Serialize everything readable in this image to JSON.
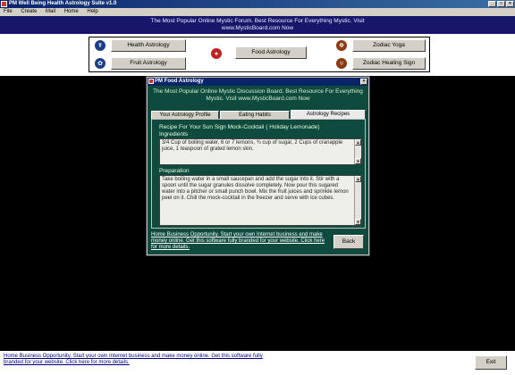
{
  "window": {
    "title": "PM Well Being Health Astrology Suite v1.0",
    "buttons": [
      "_",
      "□",
      "×"
    ]
  },
  "menu": [
    "File",
    "Create",
    "Mail",
    "Home",
    "Help"
  ],
  "banner": {
    "line1": "The Most Popular Online Mystic Forum. Best Resource For Everything Mystic. Visit",
    "line2": "www.MysticBoard.com Now"
  },
  "nav": {
    "health_astrology": "Health Astrology",
    "fruit_astrology": "Fruit Astrology",
    "food_astrology": "Food Astrology",
    "zodiac_yoga": "Zodiac Yoga",
    "zodiac_healing_sign": "Zodiac Healing Sign"
  },
  "dialog": {
    "title": "PM Food Astrology",
    "close": "×",
    "header": "The Most Popular Online Mystic Discussion Board. Best Resource For Everything Mystic. Visit www.MysticBoard.com Now",
    "tabs": [
      "Your Astrology Profile",
      "Eating Habits",
      "Astrology Recipes"
    ],
    "recipe_title": "Recipe For Your Sun Sign    Mock-Cocktail ( Holiday Lemonade)",
    "ingredients_label": "Ingredients",
    "ingredients_text": "3/4 Cup of boiling water, 6 or 7 lemons, ¾ cup of sugar, 2 Cups of cranapple juice, 1 teaspoon of grated lemon skin.",
    "preparation_label": "Preparation",
    "preparation_text": "Take boiling water in a small saucepan and add the sugar into it. Stir with a spoon until the sugar granules dissolve completely. Now pour this sugared water into a pitcher or small punch bowl. Mix the fruit juices and sprinkle lemon peel on it. Chill the mock-cocktail in the freezer and serve with ice cubes.",
    "footer_text": "Home Business Opportunity. Start your own Internet business and make money online. Get this software fully branded for your website. Click here for more details.",
    "back_label": "Back"
  },
  "status": {
    "text": "Home Business Opportunity. Start your own Internet business and make money online. Get this software fully branded for your website. Click here for more details.",
    "exit_label": "Exit"
  },
  "colors": {
    "banner_bg": "#16166a",
    "dialog_bg": "#0e4a3e",
    "title_bg": "#0a246a"
  }
}
